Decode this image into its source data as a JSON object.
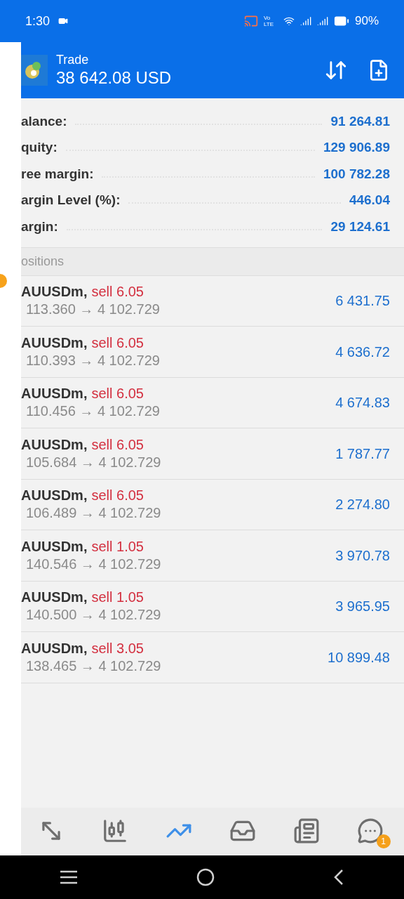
{
  "status_bar": {
    "time": "1:30",
    "network_label": "Vo LTE",
    "battery": "90%"
  },
  "header": {
    "title": "Trade",
    "balance": "38 642.08 USD"
  },
  "summary": [
    {
      "label": "alance:",
      "value": "91 264.81"
    },
    {
      "label": "quity:",
      "value": "129 906.89"
    },
    {
      "label": "ree margin:",
      "value": "100 782.28"
    },
    {
      "label": "argin Level (%):",
      "value": "446.04"
    },
    {
      "label": "argin:",
      "value": "29 124.61"
    }
  ],
  "positions_header": "ositions",
  "positions": [
    {
      "symbol": "AUUSDm,",
      "order": "sell 6.05",
      "prices": "113.360 → 4 102.729",
      "profit": "6 431.75"
    },
    {
      "symbol": "AUUSDm,",
      "order": "sell 6.05",
      "prices": "110.393 → 4 102.729",
      "profit": "4 636.72"
    },
    {
      "symbol": "AUUSDm,",
      "order": "sell 6.05",
      "prices": "110.456 → 4 102.729",
      "profit": "4 674.83"
    },
    {
      "symbol": "AUUSDm,",
      "order": "sell 6.05",
      "prices": "105.684 → 4 102.729",
      "profit": "1 787.77"
    },
    {
      "symbol": "AUUSDm,",
      "order": "sell 6.05",
      "prices": "106.489 → 4 102.729",
      "profit": "2 274.80"
    },
    {
      "symbol": "AUUSDm,",
      "order": "sell 1.05",
      "prices": "140.546 → 4 102.729",
      "profit": "3 970.78"
    },
    {
      "symbol": "AUUSDm,",
      "order": "sell 1.05",
      "prices": "140.500 → 4 102.729",
      "profit": "3 965.95"
    },
    {
      "symbol": "AUUSDm,",
      "order": "sell 3.05",
      "prices": "138.465 → 4 102.729",
      "profit": "10 899.48"
    }
  ],
  "bottom_tabs": [
    {
      "kind": "trade",
      "selected": false
    },
    {
      "kind": "chart",
      "selected": false
    },
    {
      "kind": "trend",
      "selected": true
    },
    {
      "kind": "inbox",
      "selected": false
    },
    {
      "kind": "news",
      "selected": false
    },
    {
      "kind": "chat",
      "selected": false,
      "badge": "1"
    }
  ]
}
